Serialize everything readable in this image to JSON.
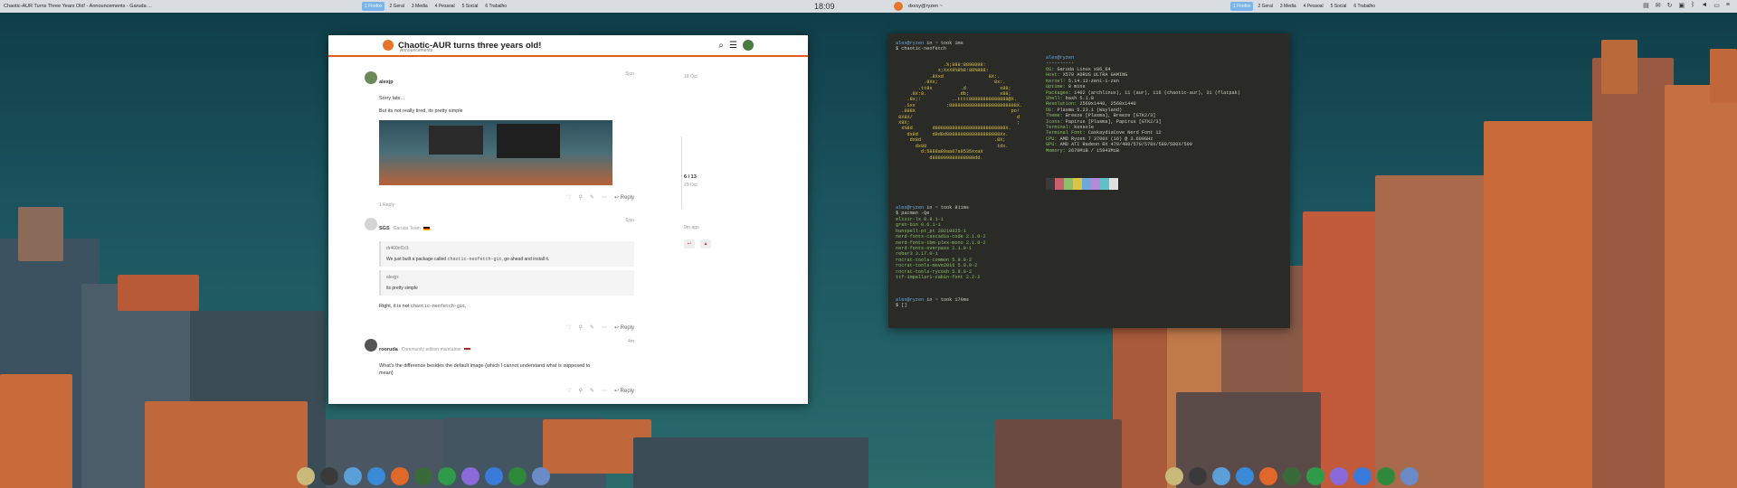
{
  "top_panel_left": {
    "window_title": "Chaotic-AUR Turns Three Years Old! - Announcements - Garuda ...",
    "desktops": [
      "1 Firefox",
      "2 Geral",
      "3 Media",
      "4 Pessoal",
      "5 Social",
      "6 Trabalho"
    ],
    "clock": "18:09"
  },
  "top_panel_right": {
    "window_title": "dxvsy@ryzen ~",
    "desktops": [
      "1 Firefox",
      "2 Geral",
      "3 Media",
      "4 Pessoal",
      "5 Social",
      "6 Trabalho"
    ],
    "tray_icons": [
      "notes-icon",
      "mail-icon",
      "refresh-icon",
      "clipboard-icon",
      "bluetooth-icon",
      "volume-icon",
      "network-icon",
      "menu-icon"
    ]
  },
  "forum": {
    "title": "Chaotic-AUR turns three years old!",
    "category": "Announcements",
    "posts": [
      {
        "author": "alexjp",
        "time": "5jun",
        "lines": [
          "Sorry late...",
          "But its not really tired, its pretty simple"
        ],
        "replies": "1 Reply",
        "reply_label": "Reply"
      },
      {
        "author": "SGS",
        "role": "Garuda Team",
        "time": "6jun",
        "quote1_author": "dr460nf1r3:",
        "quote1_text_a": "We just built a package called ",
        "quote1_code": "chaotic-neofetch-git",
        "quote1_text_b": ", go ahead and install it.",
        "quote2_author": "alexjp:",
        "quote2_text": "its pretty simple",
        "body_a": "Right, it is not ",
        "body_code": "chaotic-neofetch-git",
        "body_b": ".",
        "reply_label": "Reply"
      },
      {
        "author": "rooruda",
        "role": "Community edition maintainer",
        "time": "4m",
        "lines": [
          "What's the difference besides the default image (which I cannot understand what is supposed to",
          "mean)"
        ],
        "reply_label": "Reply"
      }
    ],
    "timeline": {
      "top_date": "18 Oct",
      "position": "6 / 13",
      "position_date": "29 Oct",
      "bottom": "9m ago"
    }
  },
  "terminal": {
    "prompt1_user": "alex@ryzen",
    "prompt1_suffix": " in ~ took 1ms",
    "cmd1": "$ chaotic-neofetch",
    "art": [
      "                 .%;888:8898898:",
      "               x;XxX8%8%8:88%888:",
      "            .8Xxd                8X:.",
      "          .8Xx;                    8x:.",
      "        .tt8x          .d            x88;",
      "     .8X:8.           .db;           x88;",
      "    .8x;:           ..tttt88888888888888@X.",
      "   .Sxx           :888888888888888888888888X.",
      "  .888X                                  po!",
      " 8X8X/                                     d",
      " X8X;                                      ;",
      "  x%8d       d8888888888888888888888888X.",
      "    dx8d     d8d8d8888888888888888888Xx.",
      "     dx8d                          .8X;",
      "       dx88                         tdx.",
      "         d:5888a89aa67a8535xxaX",
      "            d888999888088888dd."
    ],
    "info_user": "alex@ryzen",
    "info_sep": "----------",
    "info": [
      [
        "OS",
        "Garuda Linux x86_64"
      ],
      [
        "Host",
        "X570 AORUS ULTRA GAMING"
      ],
      [
        "Kernel",
        "5.14.12-zen1-1-zen"
      ],
      [
        "Uptime",
        "8 mins"
      ],
      [
        "Packages",
        "1462 (archlinux), 11 (aur), 116 (chaotic-aur), 31 (flatpak)"
      ],
      [
        "Shell",
        "bash 5.1.8"
      ],
      [
        "Resolution",
        "2560x1440, 2560x1440"
      ],
      [
        "DE",
        "Plasma 5.23.1 (Wayland)"
      ],
      [
        "Theme",
        "Breeze [Plasma], Breeze [GTK2/3]"
      ],
      [
        "Icons",
        "Papirus [Plasma], Papirus [GTK2/3]"
      ],
      [
        "Terminal",
        "konsole"
      ],
      [
        "Terminal Font",
        "CaskaydiaCove Nerd Font 12"
      ],
      [
        "CPU",
        "AMD Ryzen 7 3700X (16) @ 3.600GHz"
      ],
      [
        "GPU",
        "AMD ATI Radeon RX 470/480/570/570X/580/580X/590"
      ],
      [
        "Memory",
        "2670MiB / 15943MiB"
      ]
    ],
    "palette": [
      "#3a3a3a",
      "#c8606e",
      "#8fbf6a",
      "#d9c54a",
      "#6fa8dc",
      "#b48ad8",
      "#5fc0c8",
      "#e0e0e0"
    ],
    "prompt2_user": "alex@ryzen",
    "prompt2_suffix": " in ~ took 811ms",
    "cmd2": "$ pacman -Qe",
    "packages": [
      "elixir-ls 0.8.1-1",
      "gren-bin 0.6.1-1",
      "hunspell-pt_pt 20210625-1",
      "nerd-fonts-cascadia-code 2.1.0-2",
      "nerd-fonts-ibm-plex-mono 2.1.0-2",
      "nerd-fonts-overpass 2.1.0-1",
      "rebar3 3.17.0-1",
      "rocrat-tools-common 5.9.0-2",
      "rocrat-tools-move2016 5.9.0-2",
      "rocrat-tools-rycosh 5.9.0-2",
      "ttf-impallari-cabin-font 2.2-2"
    ],
    "prompt3_user": "alex@ryzen",
    "prompt3_suffix": " in ~ took 170ms",
    "cmd3": "$ []"
  },
  "dock_colors": [
    "#c9b97a",
    "#3a3a3a",
    "#5a9fd8",
    "#3a8ad8",
    "#e0682a",
    "#3a6a3a",
    "#2e9a4a",
    "#8a6ad8",
    "#3a7ad8",
    "#2e8a3a",
    "#6a8ac8"
  ]
}
